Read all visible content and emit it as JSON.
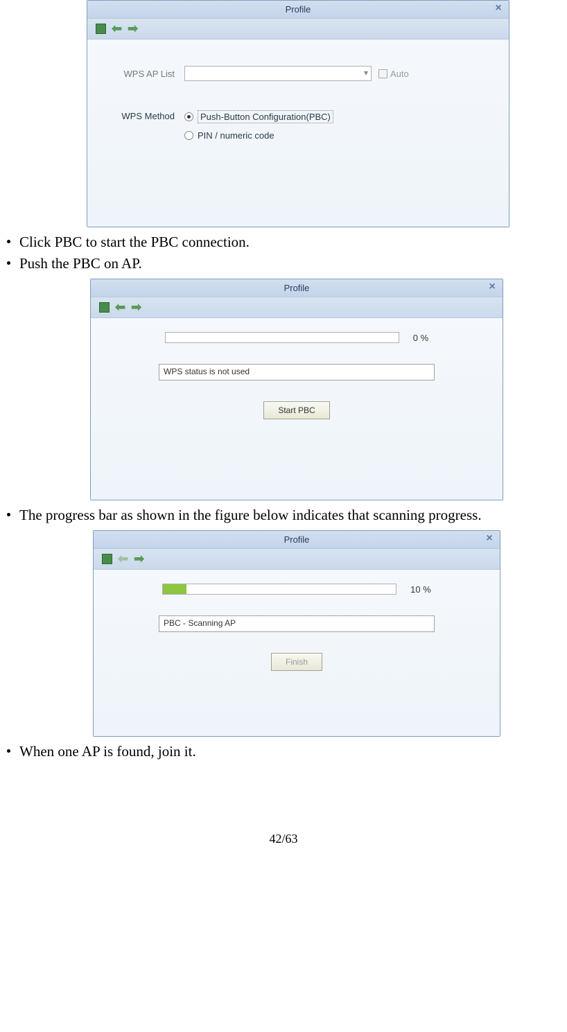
{
  "dialog1": {
    "title": "Profile",
    "wps_ap_list_label": "WPS AP List",
    "auto_label": "Auto",
    "wps_method_label": "WPS Method",
    "radio_pbc": "Push-Button Configuration(PBC)",
    "radio_pin": "PIN / numeric code"
  },
  "bullets1": {
    "item1": "Click PBC to start the PBC connection.",
    "item2": "Push the PBC on AP."
  },
  "dialog2": {
    "title": "Profile",
    "progress_pct": "0 %",
    "status_text": "WPS status is not used",
    "button_label": "Start PBC"
  },
  "bullets2": {
    "item1": "The progress bar as shown in the figure below indicates that scanning progress."
  },
  "dialog3": {
    "title": "Profile",
    "progress_pct": "10 %",
    "progress_fill_pct": "10%",
    "status_text": "PBC - Scanning AP",
    "button_label": "Finish"
  },
  "bullets3": {
    "item1": "When one AP is found, join it."
  },
  "page_number": "42/63"
}
